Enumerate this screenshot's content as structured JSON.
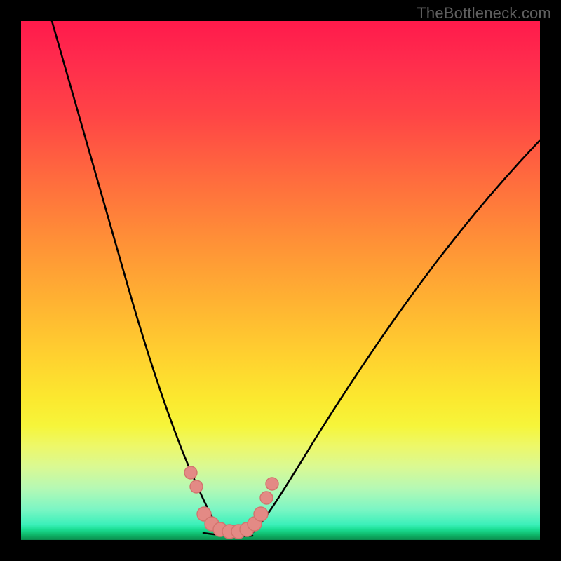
{
  "watermark": "TheBottleneck.com",
  "colors": {
    "frame": "#000000",
    "gradient_top": "#ff1a4b",
    "gradient_bottom": "#0a8a4c",
    "curve_stroke": "#000000",
    "marker_fill": "#e38a85",
    "marker_stroke": "#d2746e"
  },
  "chart_data": {
    "type": "line",
    "title": "",
    "xlabel": "",
    "ylabel": "",
    "xlim": [
      0,
      100
    ],
    "ylim": [
      0,
      100
    ],
    "grid": false,
    "note": "Axes not labeled in image; values are estimates in 0–100 visual units. y=0 is bottom of plot.",
    "series": [
      {
        "name": "left-branch",
        "x": [
          6,
          8,
          10,
          12,
          15,
          18,
          20,
          22,
          24,
          26,
          28,
          30,
          32,
          33.5,
          35,
          36,
          37,
          38
        ],
        "y": [
          100,
          91,
          82,
          73,
          62,
          52,
          46,
          40,
          34,
          28,
          23,
          18,
          13,
          10,
          7,
          5,
          3,
          2
        ]
      },
      {
        "name": "right-branch",
        "x": [
          45,
          47,
          50,
          54,
          58,
          62,
          67,
          72,
          77,
          82,
          87,
          92,
          97,
          100
        ],
        "y": [
          2,
          4,
          8,
          14,
          20,
          27,
          34,
          41,
          48,
          55,
          61,
          67,
          73,
          77
        ]
      },
      {
        "name": "flat-min",
        "x": [
          34,
          36,
          38,
          40,
          42,
          44
        ],
        "y": [
          1.2,
          0.9,
          0.7,
          0.7,
          0.9,
          1.2
        ]
      }
    ],
    "markers": {
      "name": "highlighted-points",
      "x": [
        32.5,
        33.5,
        35,
        36.5,
        38,
        39.5,
        41,
        42.5,
        44,
        45.8,
        47.2,
        48.5
      ],
      "y": [
        13,
        10,
        4.5,
        2.8,
        2,
        1.8,
        1.8,
        2,
        2.8,
        4.5,
        8,
        11
      ]
    },
    "annotations": [
      {
        "text": "TheBottleneck.com",
        "position": "top-right"
      }
    ]
  }
}
